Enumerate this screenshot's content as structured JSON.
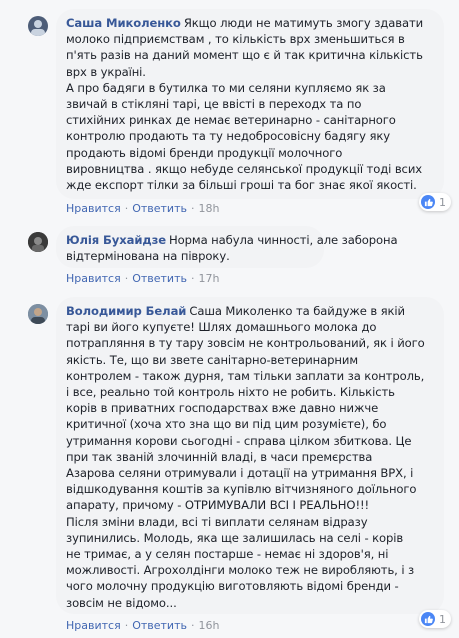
{
  "comments": [
    {
      "author": "Саша Миколенко",
      "lines": [
        "Якщо люди не матимуть змогу здавати",
        "молоко підприємствам , то кількість врх зменьшиться в",
        "п'ять разів на даний момент що є й так критична кількість",
        "врх в україні.",
        "А про бадяги в бутилка то ми селяни купляємо як за",
        "звичай в стікляні тарі, це ввісті в переходх та по",
        "стихійних ринках де немає ветеринарно - санітарного",
        "контролю продають та ту недобросовісну бадягу яку",
        "продають відомі бренди продукції молочного",
        "вировництва . якщо небуде селянської продукції тоді всих",
        "жде експорт тілки за більші гроші та бог знає якої якості."
      ],
      "like_label": "Нравится",
      "reply_label": "Ответить",
      "time": "18h",
      "reaction_count": "1",
      "avatar_color": "#4d5d78"
    },
    {
      "author": "Юлія Бухайдзе",
      "lines": [
        "Норма набула чинності, але заборона",
        "відтермінована на півроку."
      ],
      "like_label": "Нравится",
      "reply_label": "Ответить",
      "time": "17h",
      "avatar_color": "#2f2f2f"
    },
    {
      "author": "Володимир Белай",
      "lines": [
        "Саша Миколенко та байдуже в якій",
        "тарі ви його купуєте! Шлях домашнього молока до",
        "потрапляння в ту тару зовсім не контрольований, як і його",
        "якість. Те, що ви звете санітарно-ветеринарним",
        "контролем - також дурня, там тільки заплати за контроль,",
        "і все, реально той контроль ніхто не робить. Кількість",
        "корів в приватних господарствах вже давно нижче",
        "критичної (хоча хто зна що ви під цим розумієте), бо",
        "утримання корови сьогодні - справа цілком збиткова. Це",
        "при так званій злочинній владі, в часи премєрства",
        "Азарова селяни отримували і дотації на утримання ВРХ, і",
        "відшкодування коштів за купівлю вітчизняного доїльного",
        "апарату, причому - ОТРИМУВАЛИ ВСІ І РЕАЛЬНО!!!",
        "Після зміни влади, всі ті виплати селянам відразу",
        "зупинились. Молодь, яка ще залишилась на селі - корів",
        "не тримає, а у селян постарше - немає ні здоров'я, ні",
        "можливості. Агрохолдінги молоко теж не виробляють, і з",
        "чого молочну продукцію виготовляють відомі бренди -",
        "зовсім не відомо..."
      ],
      "like_label": "Нравится",
      "reply_label": "Ответить",
      "time": "16h",
      "reaction_count": "1",
      "avatar_color": "#6a7f93"
    }
  ],
  "colors": {
    "author_link": "#385898",
    "action_link": "#4267b2",
    "bubble_bg": "#f2f3f5",
    "page_bg": "#f6f7f9",
    "like_blue": "#4a86f5"
  },
  "icons": {
    "reaction": "thumbs-up-icon"
  }
}
